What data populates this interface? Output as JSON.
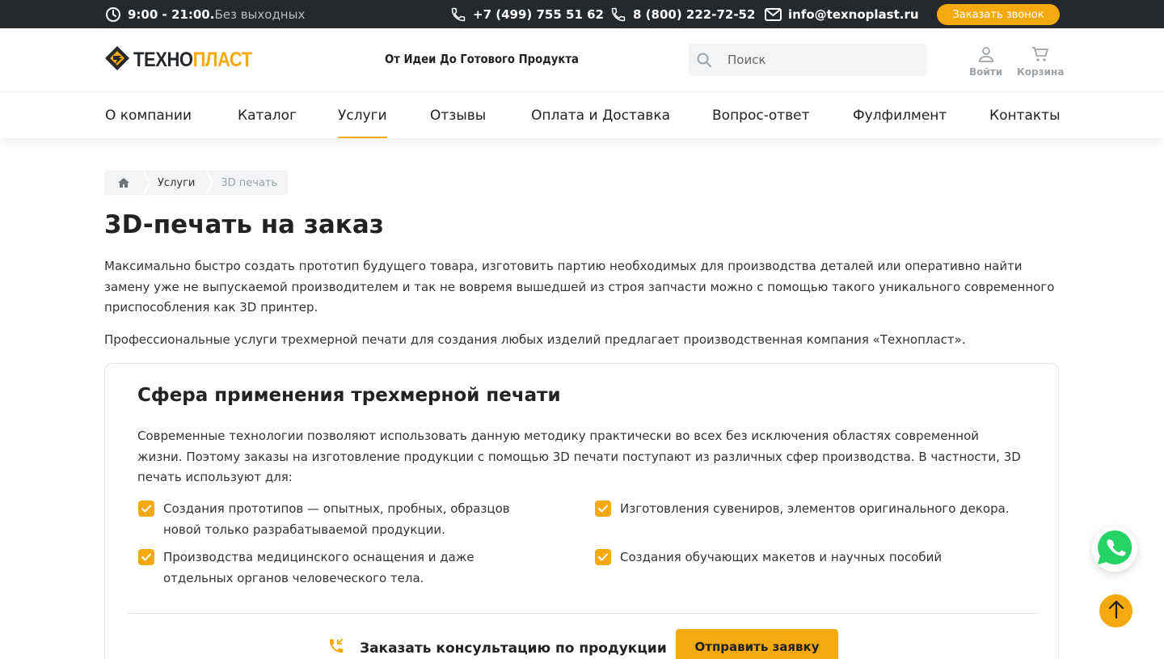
{
  "topbar": {
    "hours": "9:00 - 21:00.",
    "hours_note": "Без выходных",
    "phone1": "+7 (499) 755 51 62",
    "phone2": "8 (800) 222-72-52",
    "email": "info@texnoplast.ru",
    "callback_label": "Заказать звонок"
  },
  "header": {
    "logo_part1": "ТЕХНО",
    "logo_part2": "ПЛАСТ",
    "tagline": "От Идеи До Готового Продукта",
    "search_placeholder": "Поиск",
    "login_label": "Войти",
    "cart_label": "Корзина"
  },
  "nav": {
    "items": [
      "О компании",
      "Каталог",
      "Услуги",
      "Отзывы",
      "Оплата и Доставка",
      "Вопрос-ответ",
      "Фулфилмент",
      "Контакты"
    ],
    "active": "Услуги"
  },
  "breadcrumbs": [
    "Услуги",
    "3D печать"
  ],
  "page": {
    "title": "3D-печать на заказ",
    "intro": "Максимально быстро создать прототип будущего товара, изготовить партию необходимых для производства деталей или оперативно найти замену уже не выпускаемой производителем и так не вовремя вышедшей из строя запчасти можно с помощью такого уникального современного приспособления как 3D принтер.",
    "intro2": "Профессиональные услуги трехмерной печати для создания любых изделий предлагает производственная компания «Технопласт»."
  },
  "card": {
    "title": "Сфера применения трехмерной печати",
    "text": "Современные технологии позволяют использовать данную методику практически во всех без исключения областях современной жизни. Поэтому заказы на изготовление продукции с помощью 3D печати поступают из различных сфер производства. В частности, 3D печать используют для:",
    "items": [
      "Создания прототипов — опытных, пробных, образцов новой только разрабатываемой продукции.",
      "Изготовления сувениров, элементов оригинального декора.",
      "Производства медицинского оснащения и даже отдельных органов человеческого тела.",
      "Создания обучающих макетов и научных пособий"
    ],
    "consult_label": "Заказать консультацию по продукции",
    "send_label": "Отправить заявку"
  },
  "colors": {
    "accent": "#f4a90e",
    "dark": "#26292c",
    "whatsapp": "#25d366"
  }
}
